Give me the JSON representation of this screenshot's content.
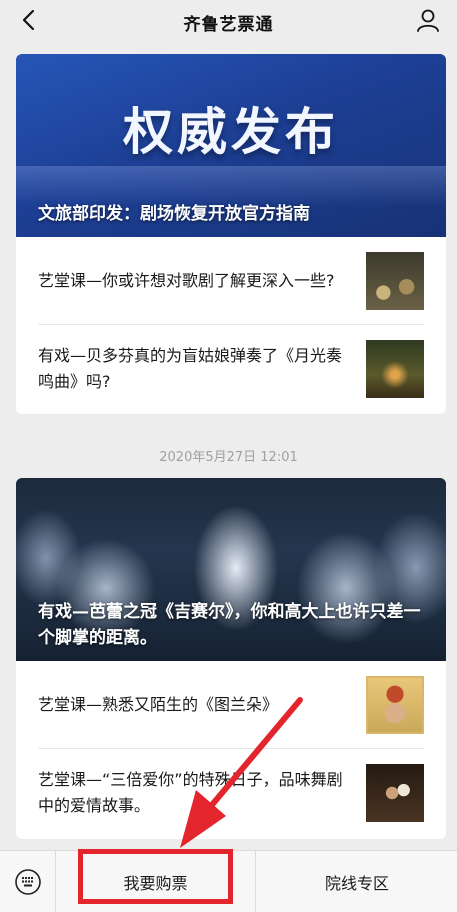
{
  "navbar": {
    "title": "齐鲁艺票通",
    "back_icon": "chevron-left-icon",
    "profile_icon": "user-icon"
  },
  "feed": [
    {
      "cover_bigword": "权威发布",
      "cover_caption": "文旅部印发：剧场恢复开放官方指南",
      "items": [
        {
          "title": "艺堂课—你或许想对歌剧了解更深入一些?"
        },
        {
          "title": "有戏—贝多芬真的为盲姑娘弹奏了《月光奏鸣曲》吗?"
        }
      ]
    },
    {
      "timestamp": "2020年5月27日 12:01",
      "cover_caption": "有戏—芭蕾之冠《吉赛尔》，你和高大上也许只差一个脚掌的距离。",
      "items": [
        {
          "title": "艺堂课—熟悉又陌生的《图兰朵》"
        },
        {
          "title": "艺堂课—“三倍爱你”的特殊日子，品味舞剧中的爱情故事。"
        }
      ]
    }
  ],
  "bottom_menu": {
    "keyboard_icon": "keyboard-icon",
    "items": [
      {
        "label": "我要购票"
      },
      {
        "label": "院线专区"
      }
    ]
  },
  "colors": {
    "background": "#ededed",
    "annotation_red": "#e3262d",
    "cover_blue": "#1d3f95"
  }
}
